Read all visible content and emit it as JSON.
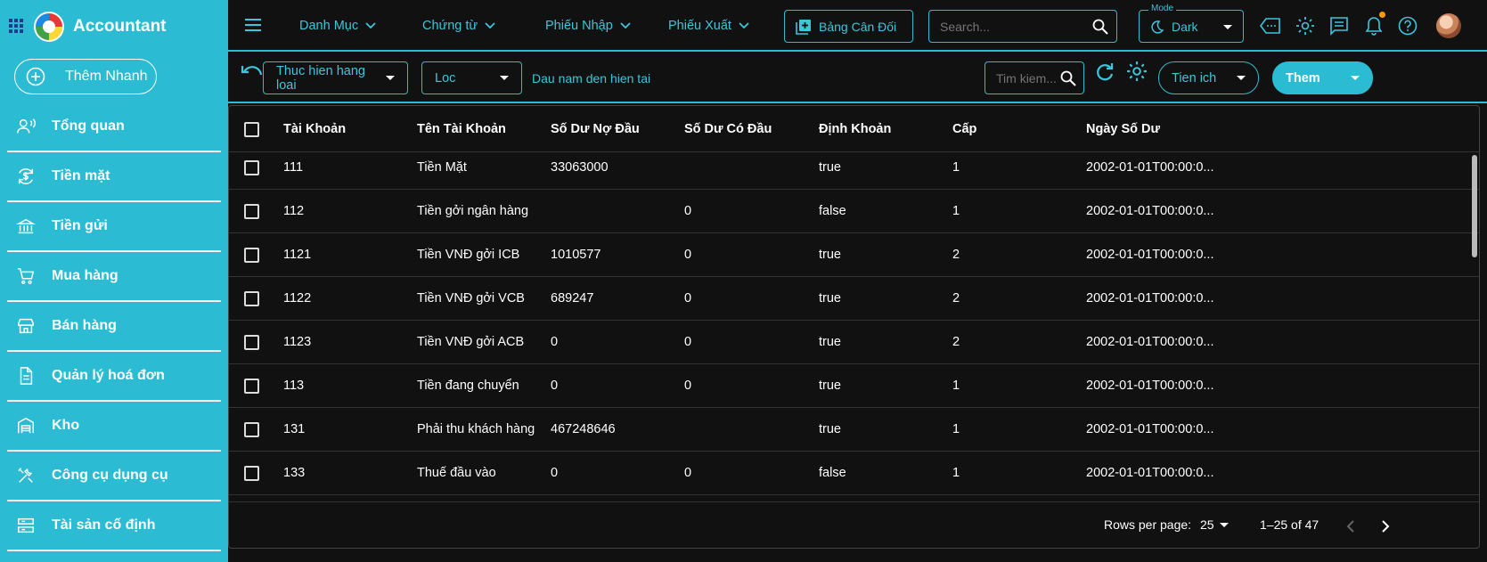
{
  "app": {
    "name": "Accountant"
  },
  "sidebar": {
    "quick_add": "Thêm Nhanh",
    "items": [
      {
        "label": "Tổng quan"
      },
      {
        "label": "Tiền mặt"
      },
      {
        "label": "Tiền gửi"
      },
      {
        "label": "Mua hàng"
      },
      {
        "label": "Bán hàng"
      },
      {
        "label": "Quản lý hoá đơn"
      },
      {
        "label": "Kho"
      },
      {
        "label": "Công cụ dụng cụ"
      },
      {
        "label": "Tài sản cố định"
      }
    ]
  },
  "topbar": {
    "menus": [
      "Danh Mục",
      "Chứng từ",
      "Phiếu Nhập",
      "Phiếu Xuất"
    ],
    "balance_button": "Bảng Cân Đối",
    "search_placeholder": "Search...",
    "mode_label": "Mode",
    "mode_value": "Dark"
  },
  "toolbar": {
    "action_select": "Thuc hien hang loai",
    "filter_select": "Loc",
    "period_text": "Dau nam den hien tai",
    "search_placeholder": "Tim kiem...",
    "utilities": "Tien ich",
    "add": "Them"
  },
  "table": {
    "columns": [
      "Tài Khoản",
      "Tên Tài Khoản",
      "Số Dư Nợ Đầu",
      "Số Dư Có Đầu",
      "Định Khoản",
      "Cấp",
      "Ngày Số Dư"
    ],
    "rows": [
      [
        "111",
        "Tiền Mặt",
        "33063000",
        "",
        "true",
        "1",
        "2002-01-01T00:00:0..."
      ],
      [
        "112",
        "Tiền gởi ngân hàng",
        "",
        "0",
        "false",
        "1",
        "2002-01-01T00:00:0..."
      ],
      [
        "1121",
        "Tiền VNĐ gởi ICB",
        "1010577",
        "0",
        "true",
        "2",
        "2002-01-01T00:00:0..."
      ],
      [
        "1122",
        "Tiền VNĐ gởi VCB",
        "689247",
        "0",
        "true",
        "2",
        "2002-01-01T00:00:0..."
      ],
      [
        "1123",
        "Tiền VNĐ gởi ACB",
        "0",
        "0",
        "true",
        "2",
        "2002-01-01T00:00:0..."
      ],
      [
        "113",
        "Tiền đang chuyển",
        "0",
        "0",
        "true",
        "1",
        "2002-01-01T00:00:0..."
      ],
      [
        "131",
        "Phải thu khách hàng",
        "467248646",
        "",
        "true",
        "1",
        "2002-01-01T00:00:0..."
      ],
      [
        "133",
        "Thuế đầu vào",
        "0",
        "0",
        "false",
        "1",
        "2002-01-01T00:00:0..."
      ]
    ]
  },
  "pagination": {
    "rows_per_page_label": "Rows per page:",
    "rows_per_page": "25",
    "range": "1–25 of 47"
  },
  "colors": {
    "accent": "#2bbcd4",
    "background": "#111111",
    "notification_dot": "#ff9800"
  }
}
